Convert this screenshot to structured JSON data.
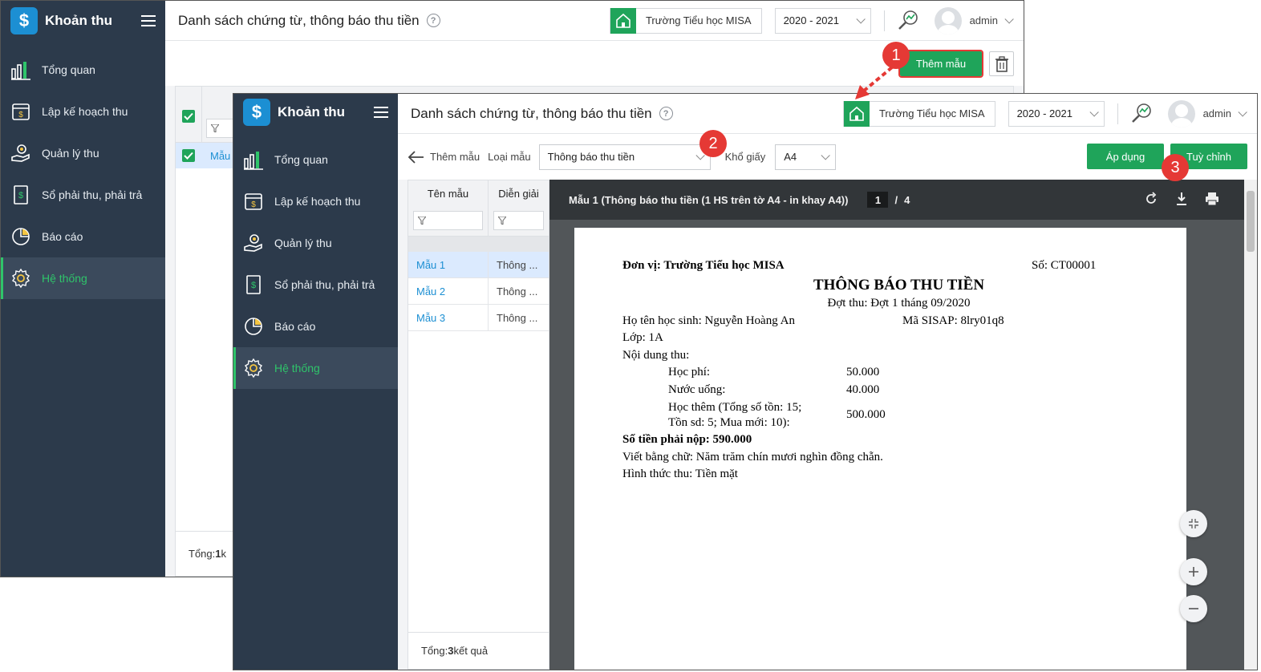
{
  "app": {
    "title": "Khoản thu",
    "page_title": "Danh sách chứng từ, thông báo thu tiền",
    "school": "Trường Tiểu học MISA",
    "year": "2020 - 2021",
    "user": "admin"
  },
  "sidebar": {
    "items": [
      {
        "label": "Tổng quan",
        "icon": "bar-chart-icon"
      },
      {
        "label": "Lập kế hoạch thu",
        "icon": "calendar-money-icon"
      },
      {
        "label": "Quản lý thu",
        "icon": "coin-hand-icon"
      },
      {
        "label": "Sổ phải thu, phải trả",
        "icon": "ledger-book-icon"
      },
      {
        "label": "Báo cáo",
        "icon": "pie-chart-icon"
      },
      {
        "label": "Hệ thống",
        "icon": "gear-icon",
        "active": true
      }
    ]
  },
  "back": {
    "add_button": "Thêm mẫu",
    "row_link": "Mẫu",
    "footer_prefix": "Tổng: ",
    "footer_count": "1",
    "footer_suffix": " k"
  },
  "front": {
    "back_label": "Thêm mẫu",
    "type_label": "Loại mẫu",
    "type_value": "Thông báo thu tiền",
    "paper_label": "Khổ giấy",
    "paper_value": "A4",
    "apply_button": "Áp dụng",
    "custom_button": "Tuỳ chỉnh",
    "list": {
      "columns": [
        "Tên mẫu",
        "Diễn giải"
      ],
      "rows": [
        {
          "name": "Mẫu 1",
          "desc": "Thông ...",
          "selected": true
        },
        {
          "name": "Mẫu 2",
          "desc": "Thông ..."
        },
        {
          "name": "Mẫu 3",
          "desc": "Thông ..."
        }
      ],
      "footer_prefix": "Tổng: ",
      "footer_count": "3",
      "footer_suffix": " kết quả"
    },
    "viewer": {
      "title": "Mẫu 1 (Thông báo thu tiền (1 HS trên tờ A4 - in khay A4))",
      "page_current": "1",
      "page_sep": "/",
      "page_total": "4"
    },
    "document": {
      "unit": "Đơn vị: Trường Tiểu học MISA",
      "number": "Số: CT00001",
      "heading": "THÔNG BÁO THU TIỀN",
      "period": "Đợt thu: Đợt 1 tháng 09/2020",
      "student": "Họ tên học sinh: Nguyễn Hoàng An",
      "sisap": "Mã SISAP: 8lry01q8",
      "class": "Lớp: 1A",
      "content_label": "Nội dung thu:",
      "fees": [
        {
          "name": "Học phí:",
          "amount": "50.000"
        },
        {
          "name": "Nước uống:",
          "amount": "40.000"
        },
        {
          "name": "Học thêm (Tổng số tồn: 15;",
          "name2": "Tồn sd: 5; Mua mới: 10):",
          "amount": "500.000"
        }
      ],
      "total": "Số tiền phải nộp: 590.000",
      "in_words": "Viết bằng chữ: Năm trăm chín mươi nghìn đồng chẵn.",
      "method": "Hình thức thu: Tiền mặt"
    }
  },
  "callouts": [
    "1",
    "2",
    "3"
  ],
  "colors": {
    "sidebar_bg": "#2c3a4b",
    "accent_green": "#1fa45a",
    "active_green": "#2fc46a",
    "link_blue": "#1c8fd3",
    "callout_red": "#e53935"
  }
}
